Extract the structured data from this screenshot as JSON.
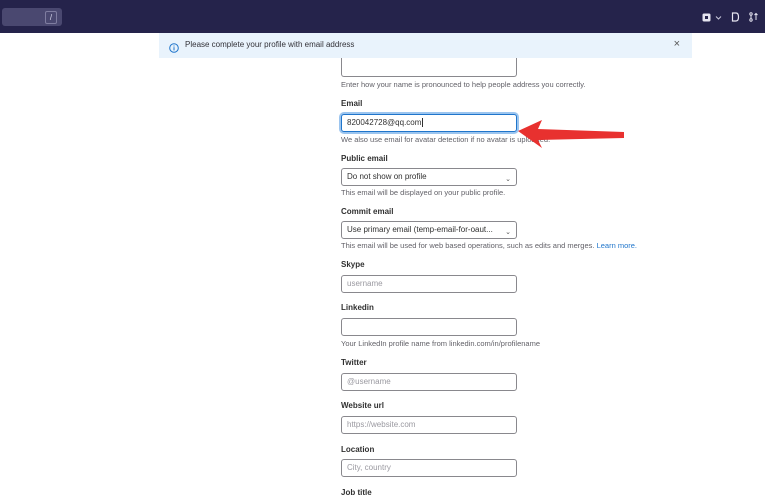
{
  "topbar": {
    "search_shortcut": "/",
    "icons": [
      "issues-icon",
      "chevron-down-icon",
      "merge-requests-icon",
      "todo-icon"
    ]
  },
  "alert": {
    "message": "Please complete your profile with email address",
    "close": "×"
  },
  "form": {
    "pronunciation_help": "Enter how your name is pronounced to help people address you correctly.",
    "email": {
      "label": "Email",
      "value": "820042728@qq.com",
      "help": "We also use email for avatar detection if no avatar is uploaded."
    },
    "public_email": {
      "label": "Public email",
      "selected": "Do not show on profile",
      "help": "This email will be displayed on your public profile."
    },
    "commit_email": {
      "label": "Commit email",
      "selected": "Use primary email (temp-email-for-oaut...",
      "help": "This email will be used for web based operations, such as edits and merges.",
      "help_link": "Learn more."
    },
    "skype": {
      "label": "Skype",
      "placeholder": "username"
    },
    "linkedin": {
      "label": "Linkedin",
      "placeholder": "",
      "help": "Your LinkedIn profile name from linkedin.com/in/profilename"
    },
    "twitter": {
      "label": "Twitter",
      "placeholder": "@username"
    },
    "website": {
      "label": "Website url",
      "placeholder": "https://website.com"
    },
    "location": {
      "label": "Location",
      "placeholder": "City, country"
    },
    "job_title": {
      "label": "Job title"
    }
  },
  "colors": {
    "topbar": "#25234b",
    "alert_bg": "#e9f3fc",
    "link": "#1f75cb",
    "annotation_arrow": "#e8312f"
  }
}
